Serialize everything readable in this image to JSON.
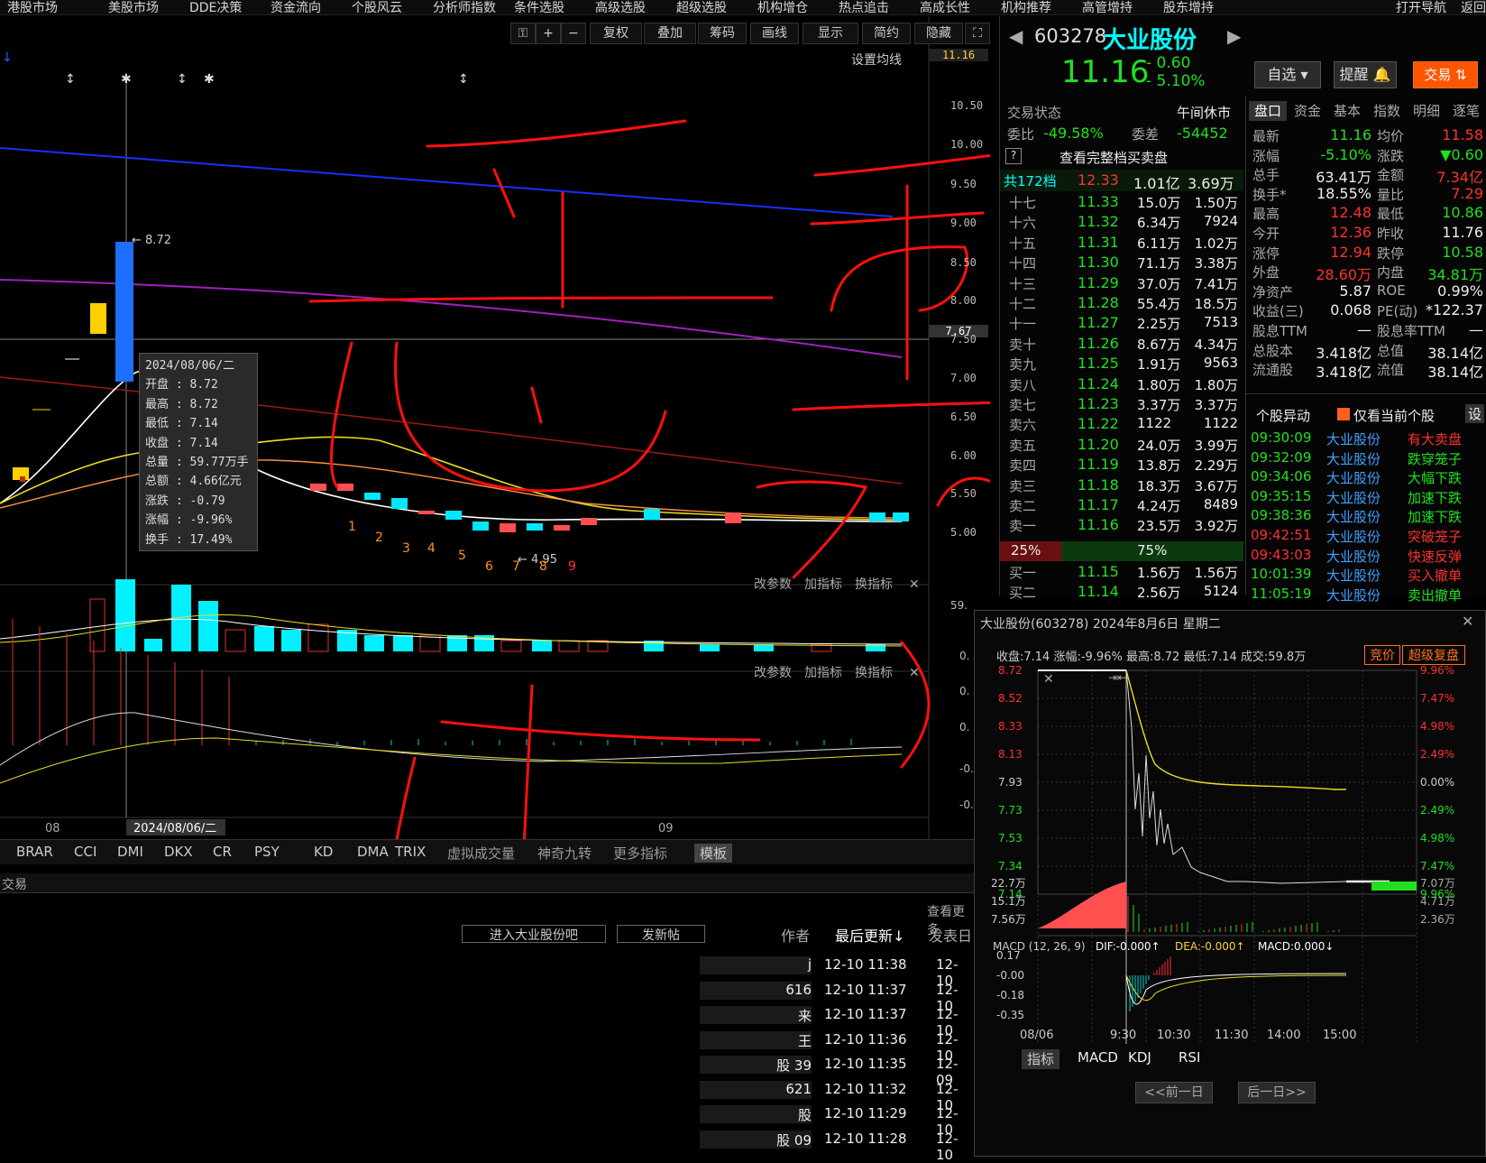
{
  "topnav": [
    "港股市场",
    "美股市场",
    "DDE决策",
    "资金流向",
    "个股风云",
    "分析师指数",
    "条件选股",
    "高级选股",
    "超级选股",
    "机构增仓",
    "热点追击",
    "高成长性",
    "机构推荐",
    "高管增持",
    "股东增持",
    "打开导航",
    "返回"
  ],
  "toolbar": {
    "buttons": [
      "复权",
      "叠加",
      "筹码",
      "画线",
      "显示",
      "简约",
      "隐藏"
    ],
    "ma_setting": "设置均线"
  },
  "price_axis": [
    "11.16",
    "10.50",
    "10.00",
    "9.50",
    "9.00",
    "8.50",
    "8.00",
    "7.67",
    "7.50",
    "7.00",
    "6.50",
    "6.00",
    "5.50",
    "5.00"
  ],
  "chart_labels": {
    "high_mark": "8.72",
    "low_mark": "4.95",
    "nine_turn": [
      "1",
      "2",
      "3",
      "4",
      "5",
      "6",
      "7",
      "8",
      "9"
    ],
    "date_axis": [
      "08",
      "2024/08/06/二",
      "09"
    ],
    "vol_axis": "59.",
    "vol_zero": "0.",
    "panel_btns": [
      "改参数",
      "加指标",
      "换指标"
    ],
    "macd_axis": [
      "0.",
      "0.",
      "-0.",
      "-0."
    ]
  },
  "tooltip": [
    {
      "k": "2024/08/06/二",
      "v": ""
    },
    {
      "k": "开盘",
      "v": "8.72"
    },
    {
      "k": "最高",
      "v": "8.72"
    },
    {
      "k": "最低",
      "v": "7.14"
    },
    {
      "k": "收盘",
      "v": "7.14"
    },
    {
      "k": "总量",
      "v": "59.77万手"
    },
    {
      "k": "总额",
      "v": "4.66亿元"
    },
    {
      "k": "涨跌",
      "v": "-0.79"
    },
    {
      "k": "涨幅",
      "v": "-9.96%"
    },
    {
      "k": "换手",
      "v": "17.49%"
    }
  ],
  "indicator_tabs": [
    "BRAR",
    "CCI",
    "DMI",
    "DKX",
    "CR",
    "PSY",
    "KD",
    "DMA",
    "TRIX",
    "虚拟成交量",
    "神奇九转",
    "更多指标",
    "模板"
  ],
  "stock": {
    "code": "603278",
    "name": "大业股份",
    "price": "11.16",
    "change": "- 0.60",
    "pct": "- 5.10%",
    "btn_watch": "自选",
    "btn_alert": "提醒",
    "btn_trade": "交易"
  },
  "status": {
    "label": "交易状态",
    "value": "午间休市",
    "wb_label": "委比",
    "wb": "-49.58%",
    "wc_label": "委差",
    "wc": "-54452",
    "full_book": "查看完整档买卖盘"
  },
  "book_summary": {
    "label": "共172档",
    "price": "12.33",
    "vol": "1.01亿",
    "amt": "3.69万"
  },
  "asks": [
    [
      "十七",
      "11.33",
      "15.0万",
      "1.50万"
    ],
    [
      "十六",
      "11.32",
      "6.34万",
      "7924"
    ],
    [
      "十五",
      "11.31",
      "6.11万",
      "1.02万"
    ],
    [
      "十四",
      "11.30",
      "71.1万",
      "3.38万"
    ],
    [
      "十三",
      "11.29",
      "37.0万",
      "7.41万"
    ],
    [
      "十二",
      "11.28",
      "55.4万",
      "18.5万"
    ],
    [
      "十一",
      "11.27",
      "2.25万",
      "7513"
    ],
    [
      "卖十",
      "11.26",
      "8.67万",
      "4.34万"
    ],
    [
      "卖九",
      "11.25",
      "1.91万",
      "9563"
    ],
    [
      "卖八",
      "11.24",
      "1.80万",
      "1.80万"
    ],
    [
      "卖七",
      "11.23",
      "3.37万",
      "3.37万"
    ],
    [
      "卖六",
      "11.22",
      "1122",
      "1122"
    ],
    [
      "卖五",
      "11.20",
      "24.0万",
      "3.99万"
    ],
    [
      "卖四",
      "11.19",
      "13.8万",
      "2.29万"
    ],
    [
      "卖三",
      "11.18",
      "18.3万",
      "3.67万"
    ],
    [
      "卖二",
      "11.17",
      "4.24万",
      "8489"
    ],
    [
      "卖一",
      "11.16",
      "23.5万",
      "3.92万"
    ]
  ],
  "ratio": {
    "buy": "25%",
    "sell": "75%",
    "buy_frac": 0.25
  },
  "bids": [
    [
      "买一",
      "11.15",
      "1.56万",
      "1.56万"
    ],
    [
      "买二",
      "11.14",
      "2.56万",
      "5124"
    ]
  ],
  "info_tabs": [
    "盘口",
    "资金",
    "基本",
    "指数",
    "明细",
    "逐笔"
  ],
  "quote": [
    [
      "最新",
      "11.16",
      "均价",
      "11.58"
    ],
    [
      "涨幅",
      "-5.10%",
      "涨跌",
      "▼0.60"
    ],
    [
      "总手",
      "63.41万",
      "金额",
      "7.34亿"
    ],
    [
      "换手*",
      "18.55%",
      "量比",
      "7.29"
    ],
    [
      "最高",
      "12.48",
      "最低",
      "10.86"
    ],
    [
      "今开",
      "12.36",
      "昨收",
      "11.76"
    ],
    [
      "涨停",
      "12.94",
      "跌停",
      "10.58"
    ],
    [
      "外盘",
      "28.60万",
      "内盘",
      "34.81万"
    ],
    [
      "净资产",
      "5.87",
      "ROE",
      "0.99%"
    ],
    [
      "收益(三)",
      "0.068",
      "PE(动)",
      "*122.37"
    ],
    [
      "股息TTM",
      "—",
      "股息率TTM",
      "—"
    ],
    [
      "总股本",
      "3.418亿",
      "总值",
      "38.14亿"
    ],
    [
      "流通股",
      "3.418亿",
      "流值",
      "38.14亿"
    ]
  ],
  "anomaly": {
    "title": "个股异动",
    "only_current": "仅看当前个股",
    "settings": "设",
    "rows": [
      [
        "09:30:09",
        "大业股份",
        "有大卖盘"
      ],
      [
        "09:32:09",
        "大业股份",
        "跌穿笼子"
      ],
      [
        "09:34:06",
        "大业股份",
        "大幅下跌"
      ],
      [
        "09:35:15",
        "大业股份",
        "加速下跌"
      ],
      [
        "09:38:36",
        "大业股份",
        "加速下跌"
      ],
      [
        "09:42:51",
        "大业股份",
        "突破笼子"
      ],
      [
        "09:43:03",
        "大业股份",
        "快速反弹"
      ],
      [
        "10:01:39",
        "大业股份",
        "买入撤单"
      ],
      [
        "11:05:19",
        "大业股份",
        "卖出撤单"
      ]
    ]
  },
  "subwin": {
    "title": "大业股份(603278) 2024年8月6日 星期二",
    "summary": "收盘:7.14 涨幅:-9.96% 最高:8.72 最低:7.14 成交:59.8万",
    "btn_auction": "竞价",
    "btn_replay": "超级复盘",
    "left_axis": [
      "8.72",
      "8.52",
      "8.33",
      "8.13",
      "7.93",
      "7.73",
      "7.53",
      "7.34",
      "7.14"
    ],
    "right_axis": [
      "9.96%",
      "7.47%",
      "4.98%",
      "2.49%",
      "0.00%",
      "2.49%",
      "4.98%",
      "7.47%",
      "9.96%"
    ],
    "vol_left": [
      "22.7万",
      "15.1万",
      "7.56万"
    ],
    "vol_right": [
      "7.07万",
      "4.71万",
      "2.36万"
    ],
    "macd_label": "MACD (12, 26, 9)",
    "dif": "DIF:-0.000↑",
    "dea": "DEA:-0.000↑",
    "macd": "MACD:0.000↓",
    "macd_axis": [
      "0.17",
      "-0.00",
      "-0.18",
      "-0.35"
    ],
    "time_axis": [
      "08/06",
      "9:30",
      "10:30",
      "11:30",
      "14:00",
      "15:00"
    ],
    "tabs": [
      "指标",
      "MACD",
      "KDJ",
      "RSI"
    ],
    "prev": "<<前一日",
    "next": "后一日>>"
  },
  "forum": {
    "tab": "交易",
    "view_more": "查看更多",
    "btn_enter": "进入大业股份吧",
    "btn_post": "发新帖",
    "cols": [
      "作者",
      "最后更新↓",
      "发表日"
    ],
    "rows": [
      [
        "j",
        "12-10 11:38",
        "12-10"
      ],
      [
        "616",
        "12-10 11:37",
        "12-10"
      ],
      [
        "来",
        "12-10 11:37",
        "12-10"
      ],
      [
        "王",
        "12-10 11:36",
        "12-10"
      ],
      [
        "股 39",
        "12-10 11:35",
        "12-09"
      ],
      [
        "621",
        "12-10 11:32",
        "12-10"
      ],
      [
        "股",
        "12-10 11:29",
        "12-10"
      ],
      [
        "股 09",
        "12-10 11:28",
        "12-10"
      ]
    ]
  },
  "colors": {
    "up": "#ff3030",
    "down": "#20e020",
    "accent": "#ff5500",
    "cyan": "#00ffff",
    "yellow": "#ffd040"
  }
}
